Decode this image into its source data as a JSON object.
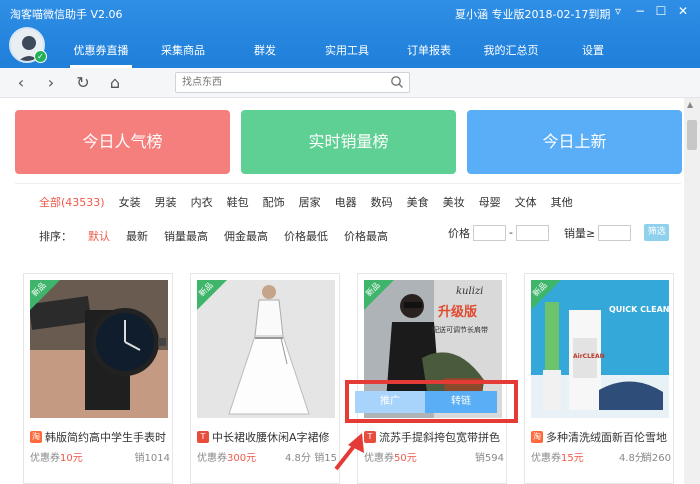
{
  "app": {
    "title": "淘客喵微信助手 V2.06",
    "user": "夏小涵",
    "version_info": "专业版2018-02-17到期"
  },
  "window_controls": [
    "menu-icon",
    "minimize-icon",
    "maximize-icon",
    "close-icon"
  ],
  "nav": [
    {
      "label": "优惠券直播",
      "active": true
    },
    {
      "label": "采集商品"
    },
    {
      "label": "群发"
    },
    {
      "label": "实用工具"
    },
    {
      "label": "订单报表"
    },
    {
      "label": "我的汇总页"
    },
    {
      "label": "设置"
    }
  ],
  "toolbar": {
    "search_placeholder": "找点东西",
    "icons": [
      "back-icon",
      "forward-icon",
      "refresh-icon",
      "home-icon",
      "search-icon"
    ]
  },
  "rank_buttons": [
    {
      "label": "今日人气榜",
      "color": "#f57f7c"
    },
    {
      "label": "实时销量榜",
      "color": "#5fd093"
    },
    {
      "label": "今日上新",
      "color": "#5aaef7"
    }
  ],
  "categories": [
    "全部(43533)",
    "女装",
    "男装",
    "内衣",
    "鞋包",
    "配饰",
    "居家",
    "电器",
    "数码",
    "美食",
    "美妆",
    "母婴",
    "文体",
    "其他"
  ],
  "sort": {
    "label": "排序：",
    "options": [
      "默认",
      "最新",
      "销量最高",
      "佣金最高",
      "价格最低",
      "价格最高"
    ]
  },
  "price_filter": {
    "price_label": "价格",
    "dash": "-",
    "sales_label": "销量≥",
    "button": "筛选"
  },
  "products": [
    {
      "tag": "新品",
      "platform": "淘",
      "title": "韩版简约高中学生手表时",
      "coupon_prefix": "优惠券",
      "coupon_value": "10元",
      "score": "",
      "sales": "销1014"
    },
    {
      "tag": "新品",
      "platform": "T",
      "title": "中长裙收腰休闲A字裙修",
      "coupon_prefix": "优惠券",
      "coupon_value": "300元",
      "score": "4.8分",
      "sales": "销15"
    },
    {
      "tag": "新品",
      "platform": "T",
      "title": "流苏手提斜挎包宽带拼色",
      "coupon_prefix": "优惠券",
      "coupon_value": "50元",
      "score": "",
      "sales": "销594"
    },
    {
      "tag": "新品",
      "platform": "淘",
      "title": "多种清洗绒面新百伦雪地",
      "coupon_prefix": "优惠券",
      "coupon_value": "15元",
      "score": "4.8分",
      "sales": "销260"
    }
  ],
  "overlay": {
    "promote": "推广",
    "convert_link": "转链"
  },
  "bag_image_text": {
    "brand": "kulizi",
    "upgrade": "升级版",
    "strap": "配送可调节长肩带"
  },
  "spray_image_text": {
    "title": "QUICK CLEAN",
    "brand": "AirCLEAN"
  },
  "colors": {
    "titlebar": "#2384de",
    "accent_red": "#f0584a",
    "new_tag": "#3fb56b"
  }
}
